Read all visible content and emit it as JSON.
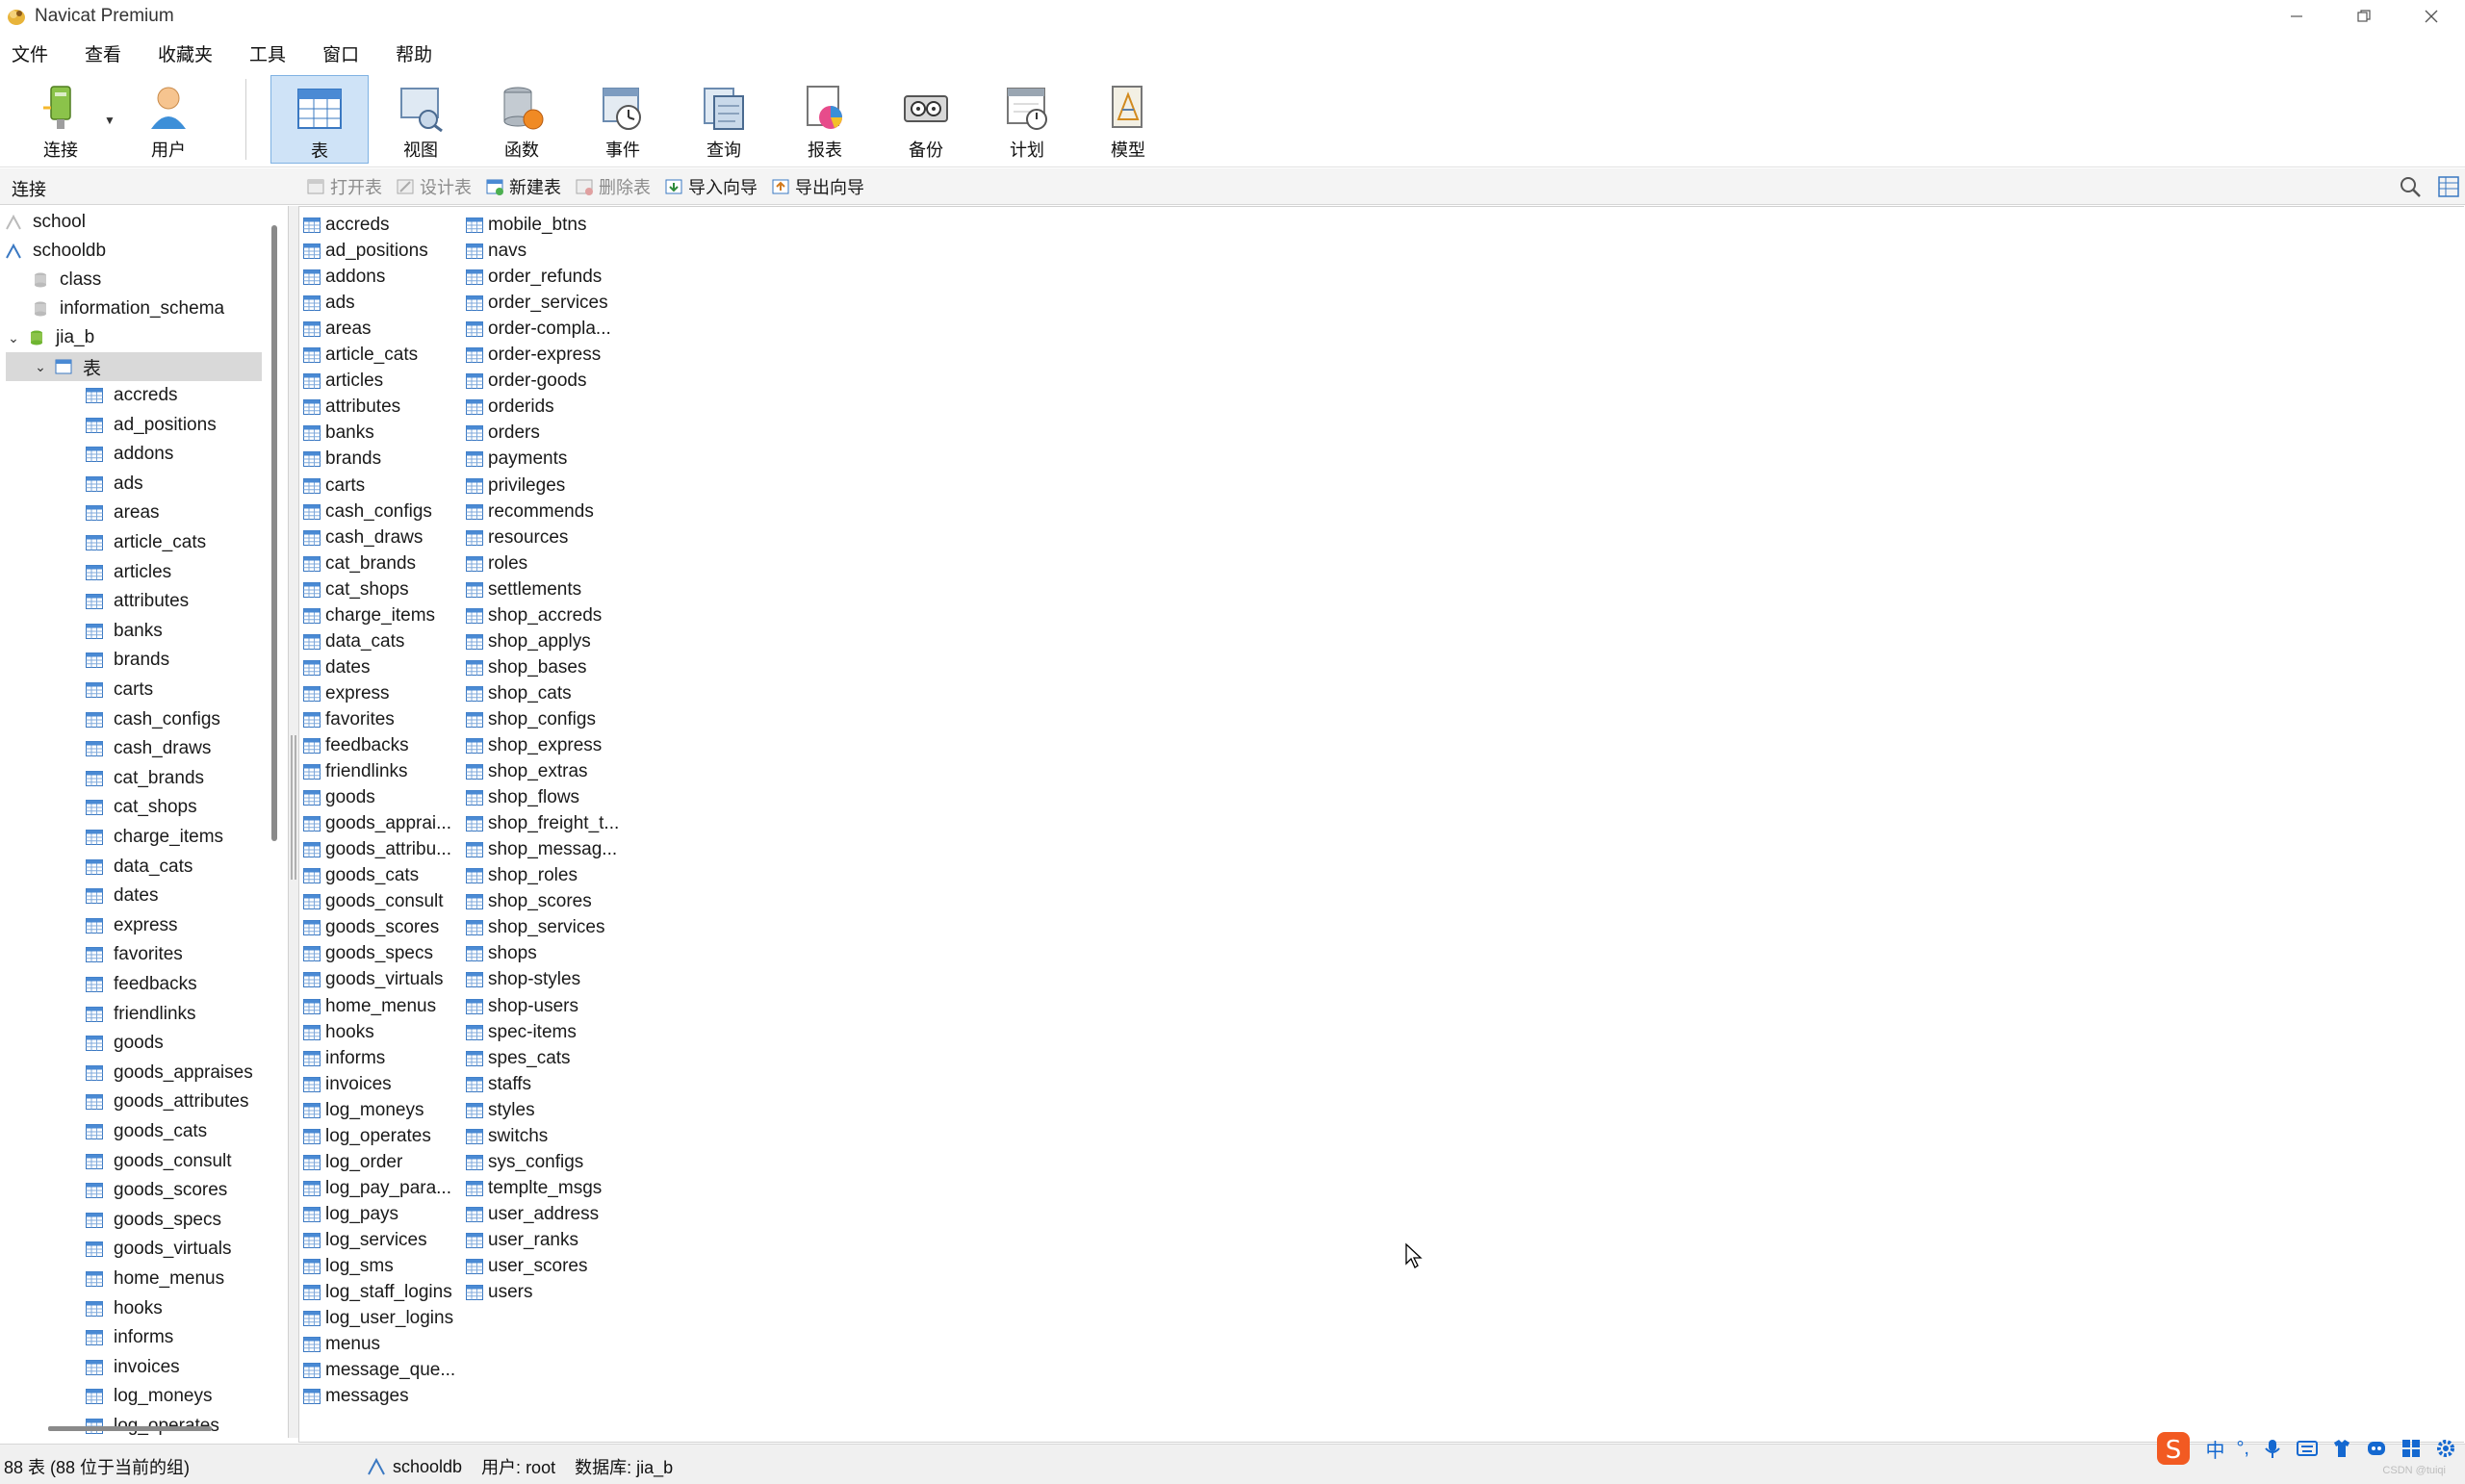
{
  "window": {
    "title": "Navicat Premium"
  },
  "menu": [
    "文件",
    "查看",
    "收藏夹",
    "工具",
    "窗口",
    "帮助"
  ],
  "toolbar": [
    {
      "label": "连接",
      "icon": "connection-icon"
    },
    {
      "label": "用户",
      "icon": "user-icon"
    },
    {
      "label": "表",
      "icon": "table-icon",
      "active": true
    },
    {
      "label": "视图",
      "icon": "view-icon"
    },
    {
      "label": "函数",
      "icon": "function-icon"
    },
    {
      "label": "事件",
      "icon": "event-icon"
    },
    {
      "label": "查询",
      "icon": "query-icon"
    },
    {
      "label": "报表",
      "icon": "report-icon"
    },
    {
      "label": "备份",
      "icon": "backup-icon"
    },
    {
      "label": "计划",
      "icon": "schedule-icon"
    },
    {
      "label": "模型",
      "icon": "model-icon"
    }
  ],
  "subbar": {
    "connection_label": "连接",
    "open_table": "打开表",
    "design_table": "设计表",
    "new_table": "新建表",
    "delete_table": "删除表",
    "import_wizard": "导入向导",
    "export_wizard": "导出向导"
  },
  "tree": {
    "connections": [
      "school",
      "schooldb"
    ],
    "databases": [
      "class",
      "information_schema",
      "jia_b"
    ],
    "tables_node": "表",
    "tables": [
      "accreds",
      "ad_positions",
      "addons",
      "ads",
      "areas",
      "article_cats",
      "articles",
      "attributes",
      "banks",
      "brands",
      "carts",
      "cash_configs",
      "cash_draws",
      "cat_brands",
      "cat_shops",
      "charge_items",
      "data_cats",
      "dates",
      "express",
      "favorites",
      "feedbacks",
      "friendlinks",
      "goods",
      "goods_appraises",
      "goods_attributes",
      "goods_cats",
      "goods_consult",
      "goods_scores",
      "goods_specs",
      "goods_virtuals",
      "home_menus",
      "hooks",
      "informs",
      "invoices",
      "log_moneys",
      "log_operates"
    ]
  },
  "tables_col1": [
    "accreds",
    "ad_positions",
    "addons",
    "ads",
    "areas",
    "article_cats",
    "articles",
    "attributes",
    "banks",
    "brands",
    "carts",
    "cash_configs",
    "cash_draws",
    "cat_brands",
    "cat_shops",
    "charge_items",
    "data_cats",
    "dates",
    "express",
    "favorites",
    "feedbacks",
    "friendlinks",
    "goods",
    "goods_apprai...",
    "goods_attribu...",
    "goods_cats",
    "goods_consult",
    "goods_scores",
    "goods_specs",
    "goods_virtuals",
    "home_menus",
    "hooks",
    "informs",
    "invoices",
    "log_moneys",
    "log_operates",
    "log_order",
    "log_pay_para...",
    "log_pays",
    "log_services",
    "log_sms",
    "log_staff_logins",
    "log_user_logins",
    "menus",
    "message_que...",
    "messages"
  ],
  "tables_col2": [
    "mobile_btns",
    "navs",
    "order_refunds",
    "order_services",
    "order-compla...",
    "order-express",
    "order-goods",
    "orderids",
    "orders",
    "payments",
    "privileges",
    "recommends",
    "resources",
    "roles",
    "settlements",
    "shop_accreds",
    "shop_applys",
    "shop_bases",
    "shop_cats",
    "shop_configs",
    "shop_express",
    "shop_extras",
    "shop_flows",
    "shop_freight_t...",
    "shop_messag...",
    "shop_roles",
    "shop_scores",
    "shop_services",
    "shops",
    "shop-styles",
    "shop-users",
    "spec-items",
    "spes_cats",
    "staffs",
    "styles",
    "switchs",
    "sys_configs",
    "templte_msgs",
    "user_address",
    "user_ranks",
    "user_scores",
    "users"
  ],
  "status": {
    "count": "88 表 (88 位于当前的组)",
    "connection": "schooldb",
    "user": "用户: root",
    "database": "数据库: jia_b"
  },
  "ime": {
    "items": [
      "中",
      "°,"
    ]
  },
  "watermark": "CSDN @tuiqi"
}
